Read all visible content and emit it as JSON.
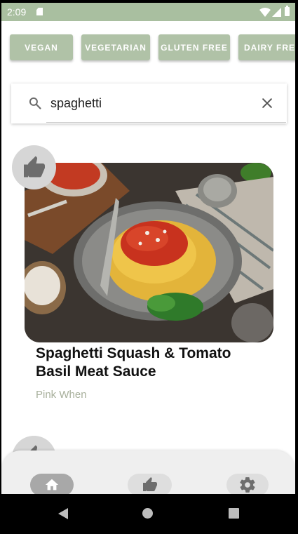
{
  "status_bar": {
    "time": "2:09"
  },
  "filters": {
    "chips": [
      {
        "label": "VEGAN"
      },
      {
        "label": "VEGETARIAN"
      },
      {
        "label": "GLUTEN FREE"
      },
      {
        "label": "DAIRY FRE"
      }
    ]
  },
  "search": {
    "value": "spaghetti"
  },
  "results": [
    {
      "title": "Spaghetti Squash & Tomato Basil Meat Sauce",
      "source": "Pink When",
      "liked_icon": "thumbs-up-icon"
    }
  ],
  "bottom_nav": {
    "items": [
      {
        "icon": "home-icon",
        "selected": true
      },
      {
        "icon": "thumbs-up-icon",
        "selected": false
      },
      {
        "icon": "gear-icon",
        "selected": false
      }
    ]
  },
  "colors": {
    "accent": "#a9bfa0",
    "chip": "#b0c2a7",
    "source_text": "#a8b09c"
  }
}
